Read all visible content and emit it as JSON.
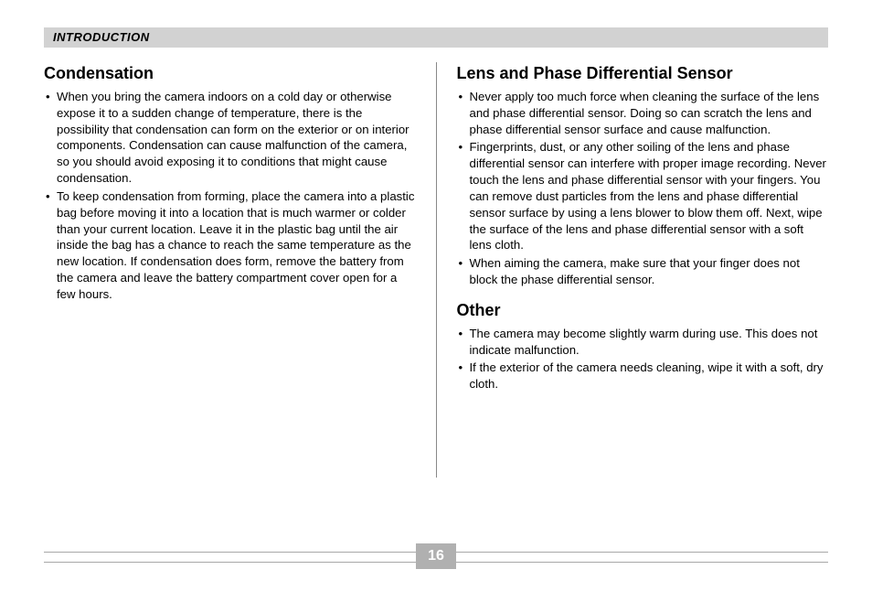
{
  "header": {
    "title": "INTRODUCTION"
  },
  "left": {
    "section1": {
      "heading": "Condensation",
      "bullets": [
        "When you bring the camera indoors on a cold day or otherwise expose it to a sudden change of temperature, there is the possibility that condensation can form on the exterior or on interior components. Condensation can cause malfunction of the camera, so you should avoid exposing it to conditions that might cause condensation.",
        "To keep condensation from forming, place the camera into a plastic bag before moving it into a location that is much warmer or colder than your current location. Leave it in the plastic bag until the air inside the bag has a chance to reach the same temperature as the new location. If condensation does form, remove the battery from the camera and leave the battery compartment cover open for a few hours."
      ]
    }
  },
  "right": {
    "section1": {
      "heading": "Lens and Phase Differential Sensor",
      "bullets": [
        "Never apply too much force when cleaning the surface of the lens and phase differential sensor. Doing so can scratch the lens and phase differential sensor surface and cause malfunction.",
        "Fingerprints, dust, or any other soiling of the lens and phase differential sensor can interfere with proper image recording. Never touch the lens and phase differential sensor with your fingers. You can remove dust particles from the lens and phase differential sensor surface by using a lens blower to blow them off. Next, wipe the surface of the lens and phase differential sensor with a soft lens cloth.",
        "When aiming the camera, make sure that your finger does not block the phase differential sensor."
      ]
    },
    "section2": {
      "heading": "Other",
      "bullets": [
        "The camera may become slightly warm during use. This does not indicate malfunction.",
        "If the exterior of the camera needs cleaning, wipe it with a soft, dry cloth."
      ]
    }
  },
  "page_number": "16"
}
